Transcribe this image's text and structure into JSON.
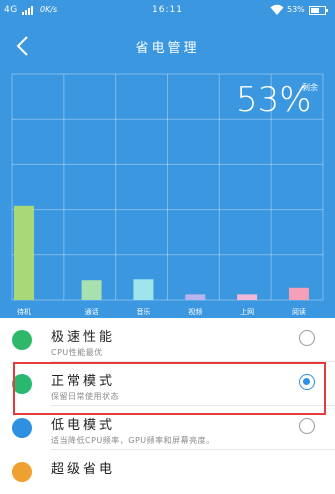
{
  "status_bar": {
    "network": "4G",
    "speed": "0K/s",
    "time": "16:11",
    "battery": "53%"
  },
  "header": {
    "title": "省电管理",
    "back_icon": "back-arrow-icon"
  },
  "battery": {
    "percent": "53%",
    "remaining_label": "剩余"
  },
  "chart_data": {
    "type": "bar",
    "categories": [
      "待机",
      "通话",
      "音乐",
      "视频",
      "上网",
      "阅读"
    ],
    "values": [
      100,
      21,
      22,
      6,
      6,
      13
    ],
    "colors": [
      "#a8d878",
      "#a8e0b0",
      "#9ee6ec",
      "#b9b4f0",
      "#f3b8d8",
      "#f59fb8"
    ],
    "ylim": [
      0,
      240
    ],
    "grid": true
  },
  "modes": [
    {
      "name": "极速性能",
      "desc": "CPU性能最优",
      "icon": "rocket-icon",
      "icon_color": "#2fb86a",
      "selected": false
    },
    {
      "name": "正常模式",
      "desc": "保留日常使用状态",
      "icon": "battery-icon",
      "icon_color": "#28b870",
      "selected": true
    },
    {
      "name": "低电模式",
      "desc": "适当降低CPU频率，GPU频率和屏幕亮度。",
      "icon": "low-battery-icon",
      "icon_color": "#2f8fe0",
      "selected": false
    },
    {
      "name": "超级省电",
      "desc": "",
      "icon": "leaf-icon",
      "icon_color": "#f0a030",
      "selected": false
    }
  ]
}
